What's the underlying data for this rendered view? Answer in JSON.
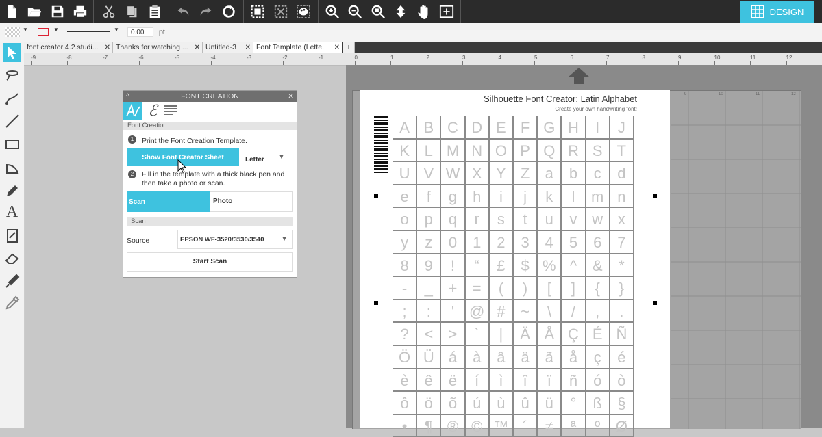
{
  "toolbar": {
    "design_label": "DESIGN",
    "icons": [
      "new-icon",
      "open-icon",
      "save-icon",
      "print-icon",
      "cut-icon",
      "copy-icon",
      "paste-icon",
      "undo-icon",
      "redo-icon",
      "refresh-icon",
      "group-icon",
      "ungroup-icon",
      "palette-icon",
      "zoom-in-icon",
      "zoom-out-icon",
      "zoom-fit-icon",
      "move-icon",
      "pan-hand-icon",
      "fit-to-page-icon"
    ]
  },
  "linebar": {
    "line_width_value": "0.00",
    "unit": "pt"
  },
  "tabs": [
    {
      "label": "font creator 4.2.studi..."
    },
    {
      "label": "Thanks for watching ..."
    },
    {
      "label": "Untitled-3"
    },
    {
      "label": "Font Template (Lette..."
    }
  ],
  "ruler": {
    "ticks_left": [
      "-9",
      "-8",
      "-7",
      "-6",
      "-5",
      "-4",
      "-3",
      "-2",
      "-1"
    ],
    "ticks_right": [
      "0",
      "1",
      "2",
      "3",
      "4",
      "5",
      "6",
      "7",
      "8",
      "9",
      "10",
      "11",
      "12"
    ]
  },
  "panel": {
    "title": "FONT CREATION",
    "section1": "Font Creation",
    "step1_num": "1",
    "step1_text": "Print the Font Creation Template.",
    "show_sheet_label": "Show Font Creator Sheet",
    "paper_size": "Letter",
    "step2_num": "2",
    "step2_text": "Fill in the template with a thick black pen and then take a photo or scan.",
    "scan_tab": "Scan",
    "photo_tab": "Photo",
    "section2": "Scan",
    "source_label": "Source",
    "source_value": "EPSON WF-3520/3530/3540",
    "start_scan_label": "Start Scan"
  },
  "sheet": {
    "title": "Silhouette Font Creator: Latin Alphabet",
    "subtitle": "Create your own handwriting font!",
    "rows": [
      [
        "A",
        "B",
        "C",
        "D",
        "E",
        "F",
        "G",
        "H",
        "I",
        "J"
      ],
      [
        "K",
        "L",
        "M",
        "N",
        "O",
        "P",
        "Q",
        "R",
        "S",
        "T"
      ],
      [
        "U",
        "V",
        "W",
        "X",
        "Y",
        "Z",
        "a",
        "b",
        "c",
        "d"
      ],
      [
        "e",
        "f",
        "g",
        "h",
        "i",
        "j",
        "k",
        "l",
        "m",
        "n"
      ],
      [
        "o",
        "p",
        "q",
        "r",
        "s",
        "t",
        "u",
        "v",
        "w",
        "x"
      ],
      [
        "y",
        "z",
        "0",
        "1",
        "2",
        "3",
        "4",
        "5",
        "6",
        "7"
      ],
      [
        "8",
        "9",
        "!",
        "“",
        "£",
        "$",
        "%",
        "^",
        "&",
        "*"
      ],
      [
        "-",
        "_",
        "+",
        "=",
        "(",
        ")",
        "[",
        "]",
        "{",
        "}"
      ],
      [
        ";",
        ":",
        "'",
        "@",
        "#",
        "~",
        "\\",
        "/",
        ",",
        "."
      ],
      [
        "?",
        "<",
        ">",
        "`",
        "|",
        "Ä",
        "Å",
        "Ç",
        "É",
        "Ñ"
      ],
      [
        "Ö",
        "Ü",
        "á",
        "à",
        "â",
        "ä",
        "ã",
        "å",
        "ç",
        "é"
      ],
      [
        "è",
        "ê",
        "ë",
        "í",
        "ì",
        "î",
        "ï",
        "ñ",
        "ó",
        "ò"
      ],
      [
        "ô",
        "ö",
        "õ",
        "ú",
        "ù",
        "û",
        "ü",
        "°",
        "ß",
        "§"
      ],
      [
        "•",
        "¶",
        "®",
        "©",
        "™",
        "´",
        "≠",
        "ª",
        "º",
        "Ø"
      ]
    ]
  },
  "mat": {
    "ruler_marks": [
      "9",
      "10",
      "11",
      "12"
    ]
  }
}
